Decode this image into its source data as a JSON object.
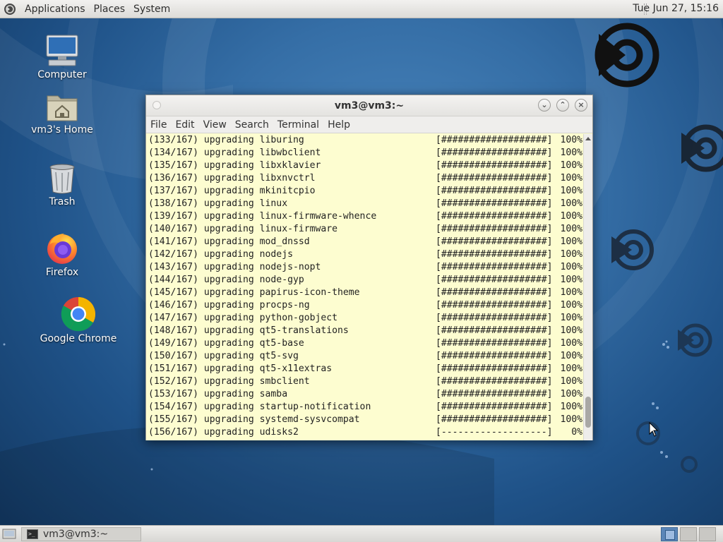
{
  "top_panel": {
    "menus": [
      "Applications",
      "Places",
      "System"
    ],
    "clock": "Tue Jun 27, 15:16"
  },
  "desktop_icons": [
    {
      "label": "Computer",
      "icon": "computer-icon"
    },
    {
      "label": "vm3's Home",
      "icon": "home-folder-icon"
    },
    {
      "label": "Trash",
      "icon": "trash-icon"
    },
    {
      "label": "Firefox",
      "icon": "firefox-icon"
    },
    {
      "label": "Google Chrome",
      "icon": "chrome-icon"
    }
  ],
  "terminal": {
    "title": "vm3@vm3:~",
    "menu": [
      "File",
      "Edit",
      "View",
      "Search",
      "Terminal",
      "Help"
    ],
    "lines": [
      {
        "text": "(133/167) upgrading liburing",
        "bar": "[###################]",
        "pct": "100%"
      },
      {
        "text": "(134/167) upgrading libwbclient",
        "bar": "[###################]",
        "pct": "100%"
      },
      {
        "text": "(135/167) upgrading libxklavier",
        "bar": "[###################]",
        "pct": "100%"
      },
      {
        "text": "(136/167) upgrading libxnvctrl",
        "bar": "[###################]",
        "pct": "100%"
      },
      {
        "text": "(137/167) upgrading mkinitcpio",
        "bar": "[###################]",
        "pct": "100%"
      },
      {
        "text": "(138/167) upgrading linux",
        "bar": "[###################]",
        "pct": "100%"
      },
      {
        "text": "(139/167) upgrading linux-firmware-whence",
        "bar": "[###################]",
        "pct": "100%"
      },
      {
        "text": "(140/167) upgrading linux-firmware",
        "bar": "[###################]",
        "pct": "100%"
      },
      {
        "text": "(141/167) upgrading mod_dnssd",
        "bar": "[###################]",
        "pct": "100%"
      },
      {
        "text": "(142/167) upgrading nodejs",
        "bar": "[###################]",
        "pct": "100%"
      },
      {
        "text": "(143/167) upgrading nodejs-nopt",
        "bar": "[###################]",
        "pct": "100%"
      },
      {
        "text": "(144/167) upgrading node-gyp",
        "bar": "[###################]",
        "pct": "100%"
      },
      {
        "text": "(145/167) upgrading papirus-icon-theme",
        "bar": "[###################]",
        "pct": "100%"
      },
      {
        "text": "(146/167) upgrading procps-ng",
        "bar": "[###################]",
        "pct": "100%"
      },
      {
        "text": "(147/167) upgrading python-gobject",
        "bar": "[###################]",
        "pct": "100%"
      },
      {
        "text": "(148/167) upgrading qt5-translations",
        "bar": "[###################]",
        "pct": "100%"
      },
      {
        "text": "(149/167) upgrading qt5-base",
        "bar": "[###################]",
        "pct": "100%"
      },
      {
        "text": "(150/167) upgrading qt5-svg",
        "bar": "[###################]",
        "pct": "100%"
      },
      {
        "text": "(151/167) upgrading qt5-x11extras",
        "bar": "[###################]",
        "pct": "100%"
      },
      {
        "text": "(152/167) upgrading smbclient",
        "bar": "[###################]",
        "pct": "100%"
      },
      {
        "text": "(153/167) upgrading samba",
        "bar": "[###################]",
        "pct": "100%"
      },
      {
        "text": "(154/167) upgrading startup-notification",
        "bar": "[###################]",
        "pct": "100%"
      },
      {
        "text": "(155/167) upgrading systemd-sysvcompat",
        "bar": "[###################]",
        "pct": "100%"
      },
      {
        "text": "(156/167) upgrading udisks2",
        "bar": "[-------------------]",
        "pct": "0%"
      }
    ]
  },
  "taskbar": {
    "task_label": "vm3@vm3:~"
  },
  "colors": {
    "terminal_bg": "#fdfdd0",
    "desktop_accent": "#2a5f96"
  }
}
